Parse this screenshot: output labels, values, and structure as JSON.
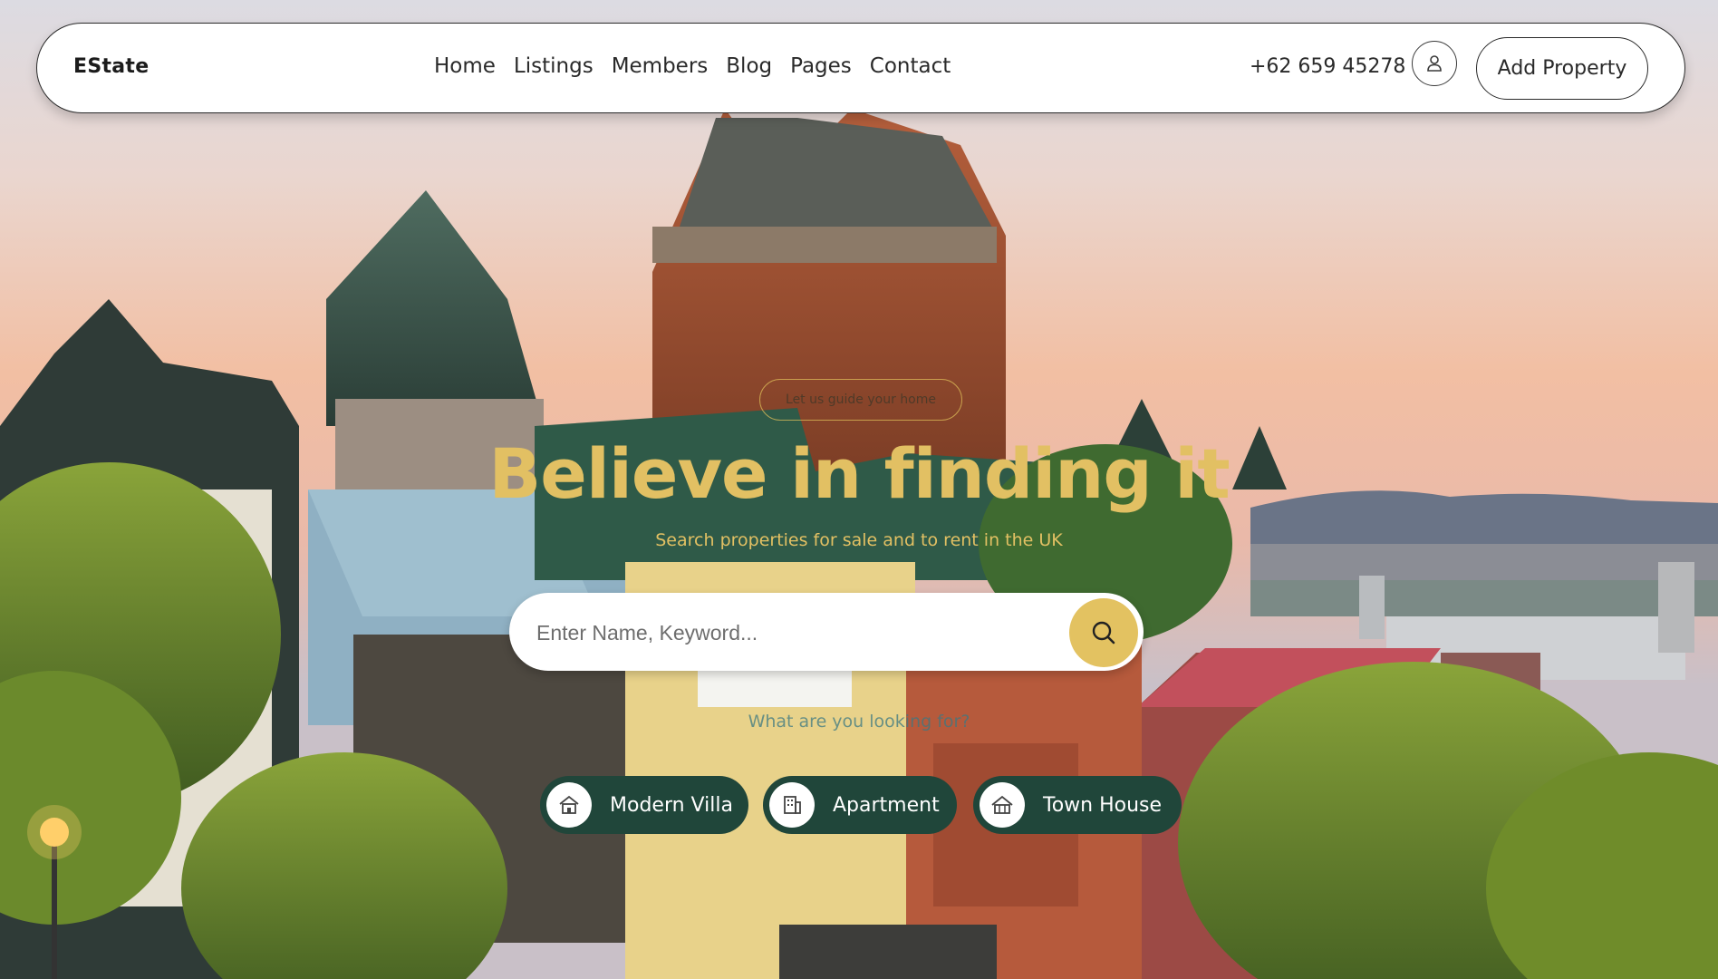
{
  "header": {
    "logo": "EState",
    "nav": [
      "Home",
      "Listings",
      "Members",
      "Blog",
      "Pages",
      "Contact"
    ],
    "phone": "+62 659 45278",
    "user_icon": "user-icon",
    "add_property": "Add Property"
  },
  "hero": {
    "tagline": "Let us guide your home",
    "title": "Believe in finding it",
    "subtitle": "Search properties for sale and to rent in the UK",
    "search": {
      "placeholder": "Enter Name, Keyword...",
      "button_icon": "search-icon"
    },
    "question": "What are you looking for?",
    "categories": [
      {
        "label": "Modern Villa",
        "icon": "villa-icon"
      },
      {
        "label": "Apartment",
        "icon": "apartment-icon"
      },
      {
        "label": "Town House",
        "icon": "town-house-icon"
      }
    ]
  },
  "colors": {
    "accent": "#e2c063",
    "category_bg": "#20463a",
    "nav_bg": "#ffffff"
  }
}
